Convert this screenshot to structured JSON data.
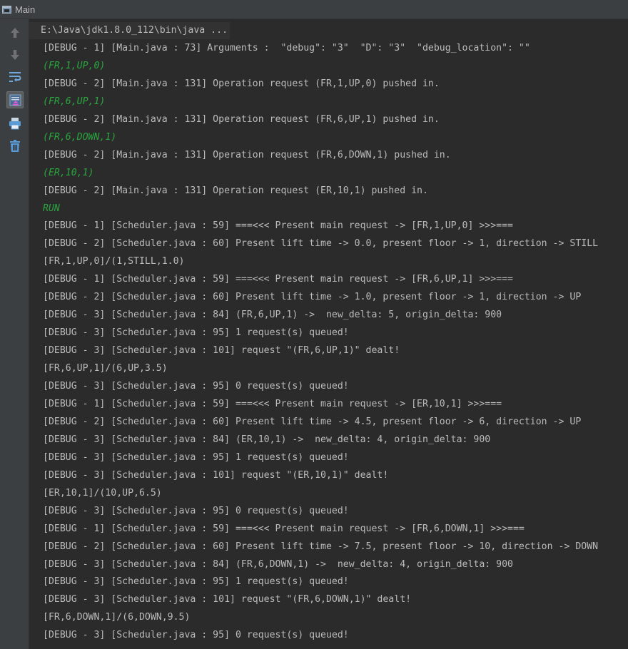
{
  "window": {
    "tab_title": "Main"
  },
  "toolbar": {
    "tools": [
      {
        "name": "rerun-up-icon",
        "label": "Up"
      },
      {
        "name": "rerun-down-icon",
        "label": "Down"
      },
      {
        "name": "soft-wrap-icon",
        "label": "Soft wrap"
      },
      {
        "name": "scroll-to-end-icon",
        "label": "Scroll to end"
      },
      {
        "name": "print-icon",
        "label": "Print"
      },
      {
        "name": "clear-all-icon",
        "label": "Clear all"
      }
    ]
  },
  "colors": {
    "background": "#2b2b2b",
    "text": "#bbbbbb",
    "input": "#2aa53f",
    "panel": "#3c3f41"
  },
  "console": {
    "lines": [
      {
        "kind": "cmd",
        "text": "E:\\Java\\jdk1.8.0_112\\bin\\java ..."
      },
      {
        "kind": "out",
        "text": "[DEBUG - 1] [Main.java : 73] Arguments :  \"debug\": \"3\"  \"D\": \"3\"  \"debug_location\": \"\""
      },
      {
        "kind": "input",
        "text": "(FR,1,UP,0)"
      },
      {
        "kind": "out",
        "text": "[DEBUG - 2] [Main.java : 131] Operation request (FR,1,UP,0) pushed in."
      },
      {
        "kind": "input",
        "text": "(FR,6,UP,1)"
      },
      {
        "kind": "out",
        "text": "[DEBUG - 2] [Main.java : 131] Operation request (FR,6,UP,1) pushed in."
      },
      {
        "kind": "input",
        "text": "(FR,6,DOWN,1)"
      },
      {
        "kind": "out",
        "text": "[DEBUG - 2] [Main.java : 131] Operation request (FR,6,DOWN,1) pushed in."
      },
      {
        "kind": "input",
        "text": "(ER,10,1)"
      },
      {
        "kind": "out",
        "text": "[DEBUG - 2] [Main.java : 131] Operation request (ER,10,1) pushed in."
      },
      {
        "kind": "input",
        "text": "RUN"
      },
      {
        "kind": "out",
        "text": "[DEBUG - 1] [Scheduler.java : 59] ===<<< Present main request -> [FR,1,UP,0] >>>==="
      },
      {
        "kind": "out",
        "text": "[DEBUG - 2] [Scheduler.java : 60] Present lift time -> 0.0, present floor -> 1, direction -> STILL"
      },
      {
        "kind": "out",
        "text": "[FR,1,UP,0]/(1,STILL,1.0)"
      },
      {
        "kind": "out",
        "text": "[DEBUG - 1] [Scheduler.java : 59] ===<<< Present main request -> [FR,6,UP,1] >>>==="
      },
      {
        "kind": "out",
        "text": "[DEBUG - 2] [Scheduler.java : 60] Present lift time -> 1.0, present floor -> 1, direction -> UP"
      },
      {
        "kind": "out",
        "text": "[DEBUG - 3] [Scheduler.java : 84] (FR,6,UP,1) ->  new_delta: 5, origin_delta: 900"
      },
      {
        "kind": "out",
        "text": "[DEBUG - 3] [Scheduler.java : 95] 1 request(s) queued!"
      },
      {
        "kind": "out",
        "text": "[DEBUG - 3] [Scheduler.java : 101] request \"(FR,6,UP,1)\" dealt!"
      },
      {
        "kind": "out",
        "text": "[FR,6,UP,1]/(6,UP,3.5)"
      },
      {
        "kind": "out",
        "text": "[DEBUG - 3] [Scheduler.java : 95] 0 request(s) queued!"
      },
      {
        "kind": "out",
        "text": "[DEBUG - 1] [Scheduler.java : 59] ===<<< Present main request -> [ER,10,1] >>>==="
      },
      {
        "kind": "out",
        "text": "[DEBUG - 2] [Scheduler.java : 60] Present lift time -> 4.5, present floor -> 6, direction -> UP"
      },
      {
        "kind": "out",
        "text": "[DEBUG - 3] [Scheduler.java : 84] (ER,10,1) ->  new_delta: 4, origin_delta: 900"
      },
      {
        "kind": "out",
        "text": "[DEBUG - 3] [Scheduler.java : 95] 1 request(s) queued!"
      },
      {
        "kind": "out",
        "text": "[DEBUG - 3] [Scheduler.java : 101] request \"(ER,10,1)\" dealt!"
      },
      {
        "kind": "out",
        "text": "[ER,10,1]/(10,UP,6.5)"
      },
      {
        "kind": "out",
        "text": "[DEBUG - 3] [Scheduler.java : 95] 0 request(s) queued!"
      },
      {
        "kind": "out",
        "text": "[DEBUG - 1] [Scheduler.java : 59] ===<<< Present main request -> [FR,6,DOWN,1] >>>==="
      },
      {
        "kind": "out",
        "text": "[DEBUG - 2] [Scheduler.java : 60] Present lift time -> 7.5, present floor -> 10, direction -> DOWN"
      },
      {
        "kind": "out",
        "text": "[DEBUG - 3] [Scheduler.java : 84] (FR,6,DOWN,1) ->  new_delta: 4, origin_delta: 900"
      },
      {
        "kind": "out",
        "text": "[DEBUG - 3] [Scheduler.java : 95] 1 request(s) queued!"
      },
      {
        "kind": "out",
        "text": "[DEBUG - 3] [Scheduler.java : 101] request \"(FR,6,DOWN,1)\" dealt!"
      },
      {
        "kind": "out",
        "text": "[FR,6,DOWN,1]/(6,DOWN,9.5)"
      },
      {
        "kind": "out",
        "text": "[DEBUG - 3] [Scheduler.java : 95] 0 request(s) queued!"
      }
    ]
  }
}
